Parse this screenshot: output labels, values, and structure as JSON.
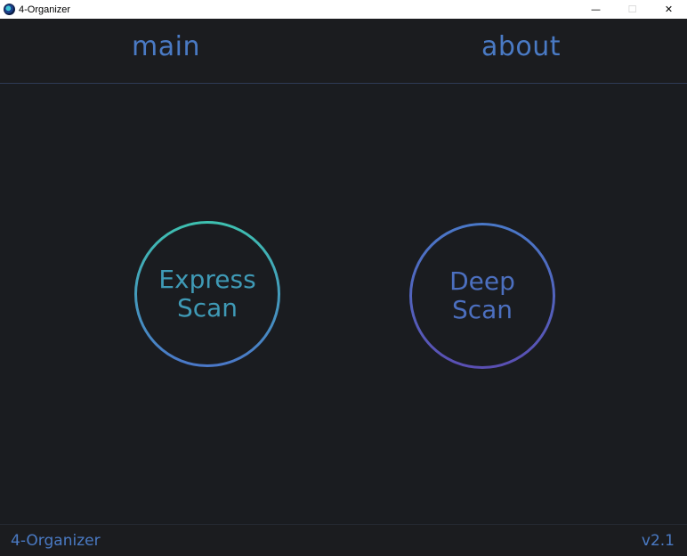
{
  "window": {
    "title": "4-Organizer",
    "controls": {
      "minimize": "—",
      "maximize": "☐",
      "close": "✕"
    }
  },
  "nav": {
    "main_label": "main",
    "about_label": "about"
  },
  "buttons": {
    "express": {
      "line1": "Express",
      "line2": "Scan"
    },
    "deep": {
      "line1": "Deep",
      "line2": "Scan"
    }
  },
  "footer": {
    "app_name": "4-Organizer",
    "version": "v2.1"
  },
  "colors": {
    "background": "#1a1c20",
    "accent_blue": "#4a7ac4",
    "accent_teal": "#3ec0b0",
    "accent_purple": "#5a4fb3"
  }
}
